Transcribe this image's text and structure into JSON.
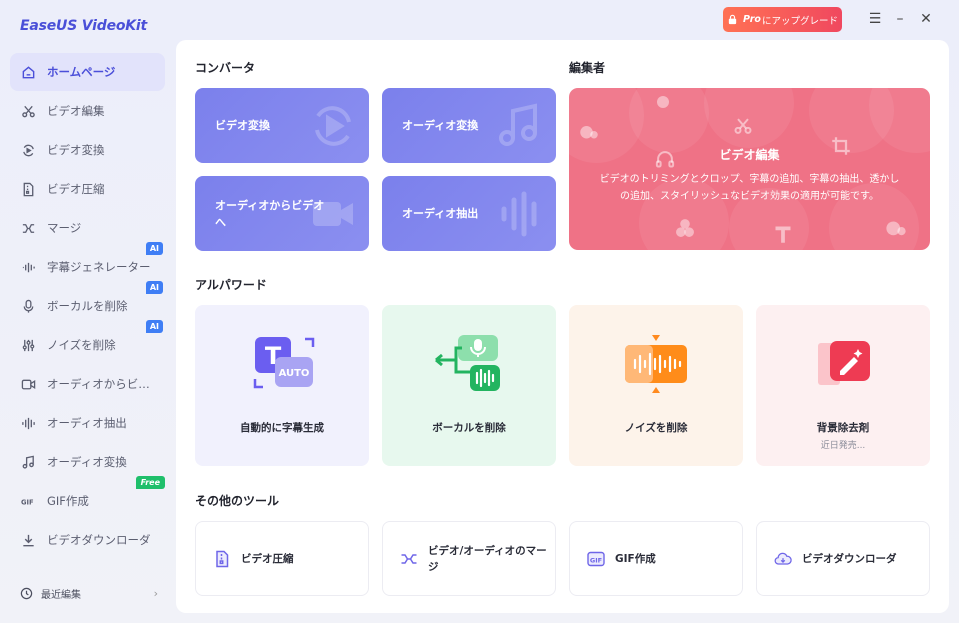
{
  "app": {
    "logo": "EaseUS VideoKit"
  },
  "titlebar": {
    "pro_strong": "Pro",
    "pro_rest": "にアップグレード",
    "menu_icon": "☰",
    "minimize_icon": "–",
    "close_icon": "✕"
  },
  "sidebar": {
    "items": [
      {
        "label": "ホームページ",
        "icon": "home-icon"
      },
      {
        "label": "ビデオ編集",
        "icon": "scissors-icon"
      },
      {
        "label": "ビデオ変換",
        "icon": "convert-icon"
      },
      {
        "label": "ビデオ圧縮",
        "icon": "compress-icon"
      },
      {
        "label": "マージ",
        "icon": "merge-icon"
      },
      {
        "label": "字幕ジェネレーター",
        "icon": "subtitle-icon",
        "badge": "AI"
      },
      {
        "label": "ボーカルを削除",
        "icon": "microphone-icon",
        "badge": "AI"
      },
      {
        "label": "ノイズを削除",
        "icon": "sliders-icon",
        "badge": "AI"
      },
      {
        "label": "オーディオからビ…",
        "icon": "audio-to-video-icon"
      },
      {
        "label": "オーディオ抽出",
        "icon": "waveform-icon"
      },
      {
        "label": "オーディオ変換",
        "icon": "music-note-icon"
      },
      {
        "label": "GIF作成",
        "icon": "gif-icon",
        "badge": "Free"
      },
      {
        "label": "ビデオダウンローダ",
        "icon": "download-icon"
      }
    ],
    "recent": "最近編集"
  },
  "converter": {
    "title": "コンバータ",
    "cards": [
      {
        "label": "ビデオ変換"
      },
      {
        "label": "オーディオ変換"
      },
      {
        "label": "オーディオからビデオへ"
      },
      {
        "label": "オーディオ抽出"
      }
    ]
  },
  "editor": {
    "title": "編集者",
    "card_title": "ビデオ編集",
    "card_desc": "ビデオのトリミングとクロップ、字幕の追加、字幕の抽出、透かしの追加、スタイリッシュなビデオ効果の適用が可能です。"
  },
  "ai_power": {
    "title": "アルパワード",
    "cards": [
      {
        "label": "自動的に字幕生成",
        "art_text": "T",
        "art_badge": "AUTO"
      },
      {
        "label": "ボーカルを削除"
      },
      {
        "label": "ノイズを削除"
      },
      {
        "label": "背景除去剤",
        "sub": "近日発売..."
      }
    ]
  },
  "other_tools": {
    "title": "その他のツール",
    "cards": [
      {
        "label": "ビデオ圧縮"
      },
      {
        "label": "ビデオ/オーディオのマージ"
      },
      {
        "label": "GIF作成"
      },
      {
        "label": "ビデオダウンローダ"
      }
    ]
  },
  "colors": {
    "accent": "#4b4fd9",
    "card_blue": "#7b80ec",
    "editor_pink": "#ef7286",
    "pro_gradient_start": "#ff7154",
    "pro_gradient_end": "#f0485f"
  }
}
